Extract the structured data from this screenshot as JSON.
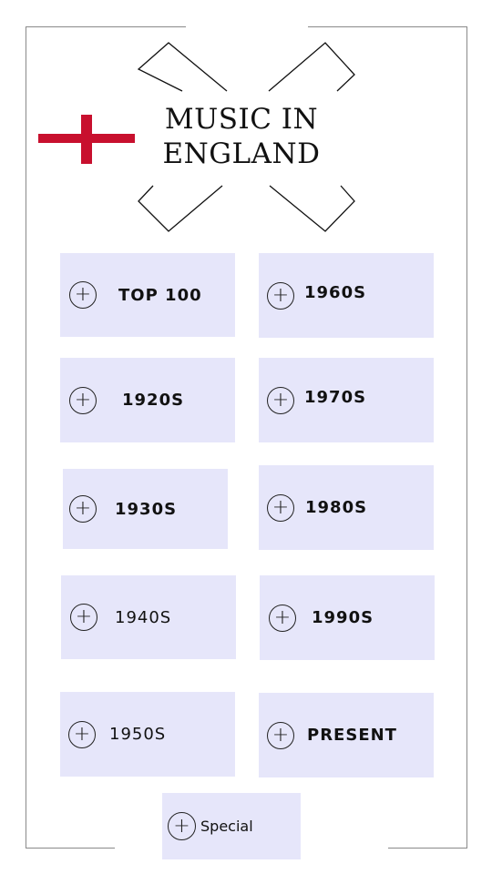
{
  "page": {
    "title_line1": "MUSIC IN",
    "title_line2": "ENGLAND"
  },
  "colors": {
    "tile_background": "#e6e6fa",
    "flag_red": "#c8102e",
    "frame": "#8a8a8a"
  },
  "icons": {
    "flag": "st-george-cross-icon",
    "decoration": "x-corner-brackets",
    "tile_icon": "plus-circle-icon"
  },
  "tiles": [
    {
      "label": "TOP 100"
    },
    {
      "label": "1960S"
    },
    {
      "label": "1920S"
    },
    {
      "label": "1970S"
    },
    {
      "label": "1930S"
    },
    {
      "label": "1980S"
    },
    {
      "label": "1940S"
    },
    {
      "label": "1990S"
    },
    {
      "label": "1950S"
    },
    {
      "label": "PRESENT"
    },
    {
      "label": "Special"
    }
  ],
  "plus_glyph": "+"
}
